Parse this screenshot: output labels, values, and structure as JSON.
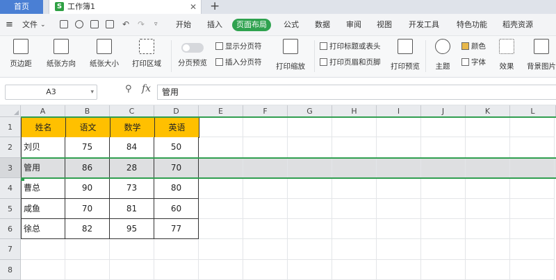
{
  "titlebar": {
    "home_tab": "首页",
    "doc_icon": "S",
    "doc_name": "工作簿1",
    "close": "✕",
    "add": "+"
  },
  "menubar": {
    "file": "文件",
    "items": [
      "开始",
      "插入",
      "页面布局",
      "公式",
      "数据",
      "审阅",
      "视图",
      "开发工具",
      "特色功能",
      "稻壳资源"
    ],
    "active": "页面布局"
  },
  "ribbon": {
    "margins": "页边距",
    "orientation": "纸张方向",
    "size": "纸张大小",
    "print_area": "打印区域",
    "page_break_preview": "分页预览",
    "show_page_break": "显示分页符",
    "insert_page_break": "插入分页符",
    "print_scale": "打印缩放",
    "print_titles": "打印标题或表头",
    "print_header_footer": "打印页眉和页脚",
    "print_preview": "打印预览",
    "theme": "主题",
    "color": "颜色",
    "font": "字体",
    "effect": "效果",
    "background": "背景图片"
  },
  "formula_bar": {
    "name_box": "A3",
    "fx": "fx",
    "value": "管用"
  },
  "columns": [
    "A",
    "B",
    "C",
    "D",
    "E",
    "F",
    "G",
    "H",
    "I",
    "J",
    "K",
    "L"
  ],
  "rows": [
    "1",
    "2",
    "3",
    "4",
    "5",
    "6",
    "7",
    "8"
  ],
  "table": {
    "headers": [
      "姓名",
      "语文",
      "数学",
      "英语"
    ],
    "data": [
      [
        "刘贝",
        "75",
        "84",
        "50"
      ],
      [
        "管用",
        "86",
        "28",
        "70"
      ],
      [
        "曹总",
        "90",
        "73",
        "80"
      ],
      [
        "咸鱼",
        "70",
        "81",
        "60"
      ],
      [
        "徐总",
        "82",
        "95",
        "77"
      ]
    ]
  },
  "colors": {
    "header_fill": "#ffc000",
    "accent_green": "#2fa24f",
    "home_tab": "#4a7fd4"
  }
}
